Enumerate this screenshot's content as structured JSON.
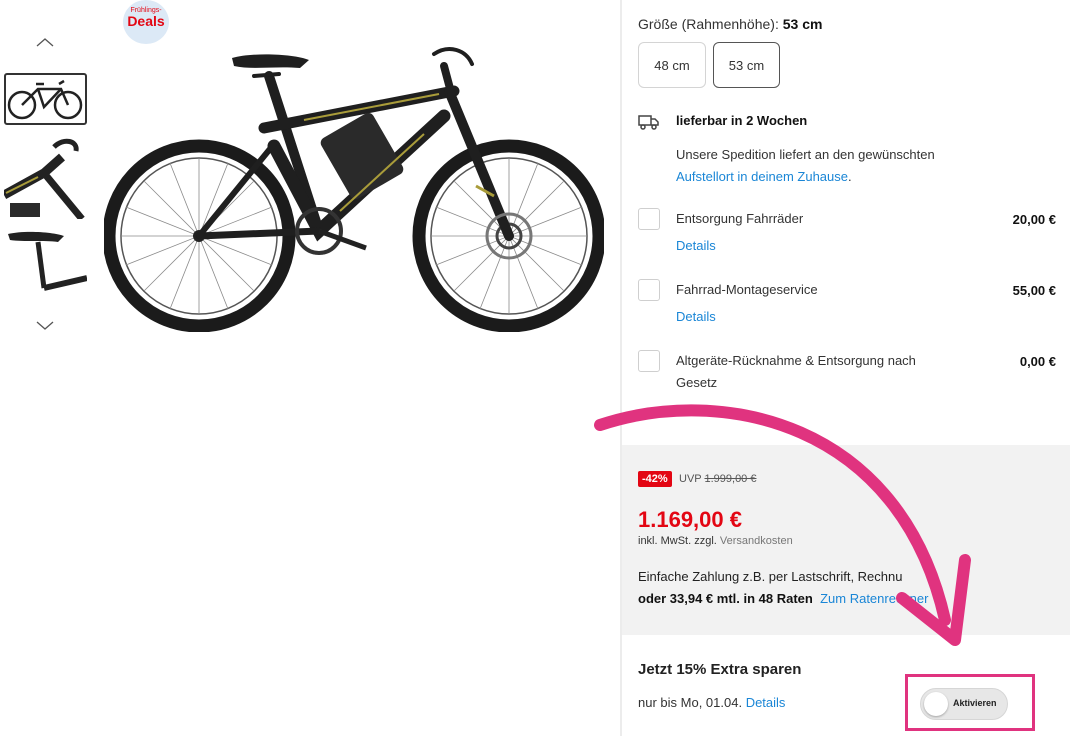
{
  "badge": {
    "line1": "Frühlings-",
    "line2": "Deals"
  },
  "gallery": {
    "thumbnails": [
      {
        "name": "full bike"
      },
      {
        "name": "handlebar detail"
      },
      {
        "name": "saddle detail"
      }
    ]
  },
  "size": {
    "label": "Größe (Rahmenhöhe):",
    "selected": "53 cm",
    "options": [
      "48 cm",
      "53 cm"
    ]
  },
  "delivery": {
    "icon": "truck-icon",
    "title": "lieferbar in 2 Wochen",
    "text": "Unsere Spedition liefert an den gewünschten",
    "link": "Aufstellort in deinem Zuhause",
    "link_suffix": "."
  },
  "services": [
    {
      "label": "Entsorgung Fahrräder",
      "price": "20,00 €",
      "details": "Details"
    },
    {
      "label": "Fahrrad-Montageservice",
      "price": "55,00 €",
      "details": "Details"
    },
    {
      "label": "Altgeräte-Rücknahme & Entsorgung nach Gesetz",
      "price": "0,00 €"
    }
  ],
  "price": {
    "discount": "-42%",
    "uvp_label": "UVP",
    "uvp_value": "1.999,00 €",
    "current": "1.169,00 €",
    "tax": "inkl. MwSt. zzgl.",
    "shipping": "Versandkosten",
    "payment_line": "Einfache Zahlung z.B. per Lastschrift, Rechnu",
    "installment": "oder 33,94 € mtl. in 48 Raten",
    "installment_link": "Zum Ratenrechner"
  },
  "promo": {
    "title": "Jetzt 15% Extra sparen",
    "until": "nur bis Mo, 01.04.",
    "details": "Details",
    "toggle_label": "Aktivieren",
    "toggle_on": false
  },
  "colors": {
    "accent_red": "#e30613",
    "link_blue": "#1a86d6",
    "annotation_pink": "#e0337f"
  }
}
